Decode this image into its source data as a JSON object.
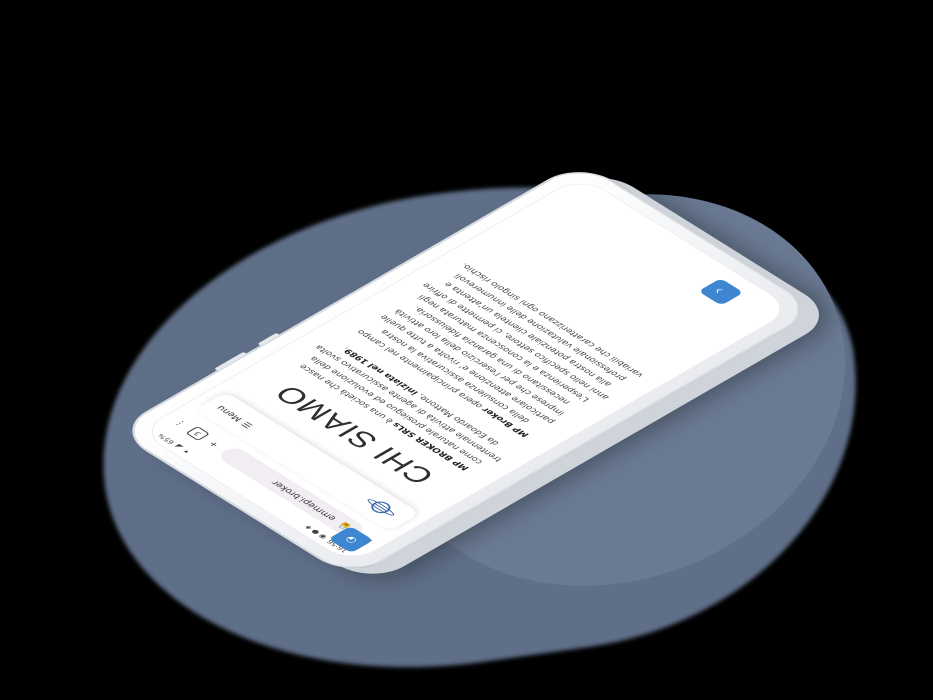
{
  "status": {
    "time": "16:56",
    "battery": "65%"
  },
  "browser": {
    "url": "emmepi.broker",
    "tab_count": "3",
    "new_tab_label": "+",
    "more_label": "⋮"
  },
  "nav": {
    "menu_label": "Menu"
  },
  "page": {
    "title": "CHI SIAMO",
    "para1_strong": "MP BROKER SRLs",
    "para1_text": " è una società che nasce come naturale prosieguo ed evoluzione della trentennale attività di agente assicurativo svolta da Edoardo Mattone, ",
    "para1_strong2": "iniziata nel 1989",
    "para1_end": ".",
    "para2_strong": "MP Broker",
    "para2_text": " opera principalmente nel campo della consulenza assicurativa la nostra particolare attenzione e' rivolta a tutte quelle imprese che per l'esercizio della loro attività necessitano di una garanzia fideiussoria. L'esperienza e la conoscenza maturata negli anni nello specifico settore, ci permette di offrire alla nostra potenziale clientela un'attenta e professionale valutazione delle innumerevoli variabili che caratterizzano ogni singolo rischio."
  },
  "buttons": {
    "scroll_top": "^"
  },
  "colors": {
    "accent": "#3f86d1",
    "shadow": "#5f6f88",
    "background": "#000000"
  }
}
